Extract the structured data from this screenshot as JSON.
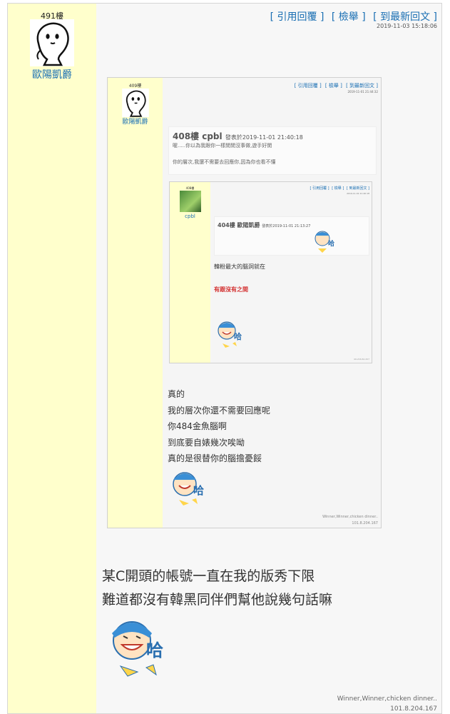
{
  "post": {
    "floor": "491樓",
    "author": "歐陽凱爵",
    "links": [
      "[ 引用回覆 ]",
      "[ 檢舉 ]",
      "[ 到最新回文 ]"
    ],
    "time": "2019-11-03 15:18:06",
    "body_lines": [
      "某C開頭的帳號一直在我的版秀下限",
      "難道都沒有韓黑同伴們幫他說幾句話嘛"
    ],
    "signature": "Winner,Winner,chicken dinner..",
    "ip": "101.8.204.167",
    "sticker_text": "哈"
  },
  "quoted_409": {
    "floor": "409樓",
    "author": "歐陽凱爵",
    "links": [
      "[ 引用回覆 ]",
      "[ 檢舉 ]",
      "[ 到最新回文 ]"
    ],
    "time": "2019-11-01 21:44:32",
    "quote_header": "408樓 cpbl",
    "quote_posted": "發表於2019-11-01 21:40:18",
    "quote_line1": "喔.....你以為我跟你一樣閒閒沒事做,遊手好閒",
    "quote_line2": "你的層次,我還不需要去回應你,因為你也看不懂",
    "body_lines": [
      "真的",
      "我的層次你還不需要回應呢",
      "你484金魚腦啊",
      "到底要自婊幾次唉呦",
      "真的是很替你的腦擔憂餒"
    ],
    "signature": "Winner,Winner,chicken dinner..",
    "ip": "101.8.204.167",
    "sticker_text": "哈"
  },
  "quoted_408": {
    "floor": "408樓",
    "author": "cpbl",
    "links": [
      "[ 引用回覆 ]",
      "[ 檢舉 ]",
      "[ 到最新回文 ]"
    ],
    "time": "2019-11-01 21:40:18",
    "quote_header": "404樓 歐陽凱爵",
    "quote_posted": "發表於2019-11-01 21:13:27",
    "line1": "韓粉最大的腦洞就在",
    "line2": "有跟沒有之間",
    "footer": "49.216.62.207",
    "sticker_text": "哈"
  }
}
